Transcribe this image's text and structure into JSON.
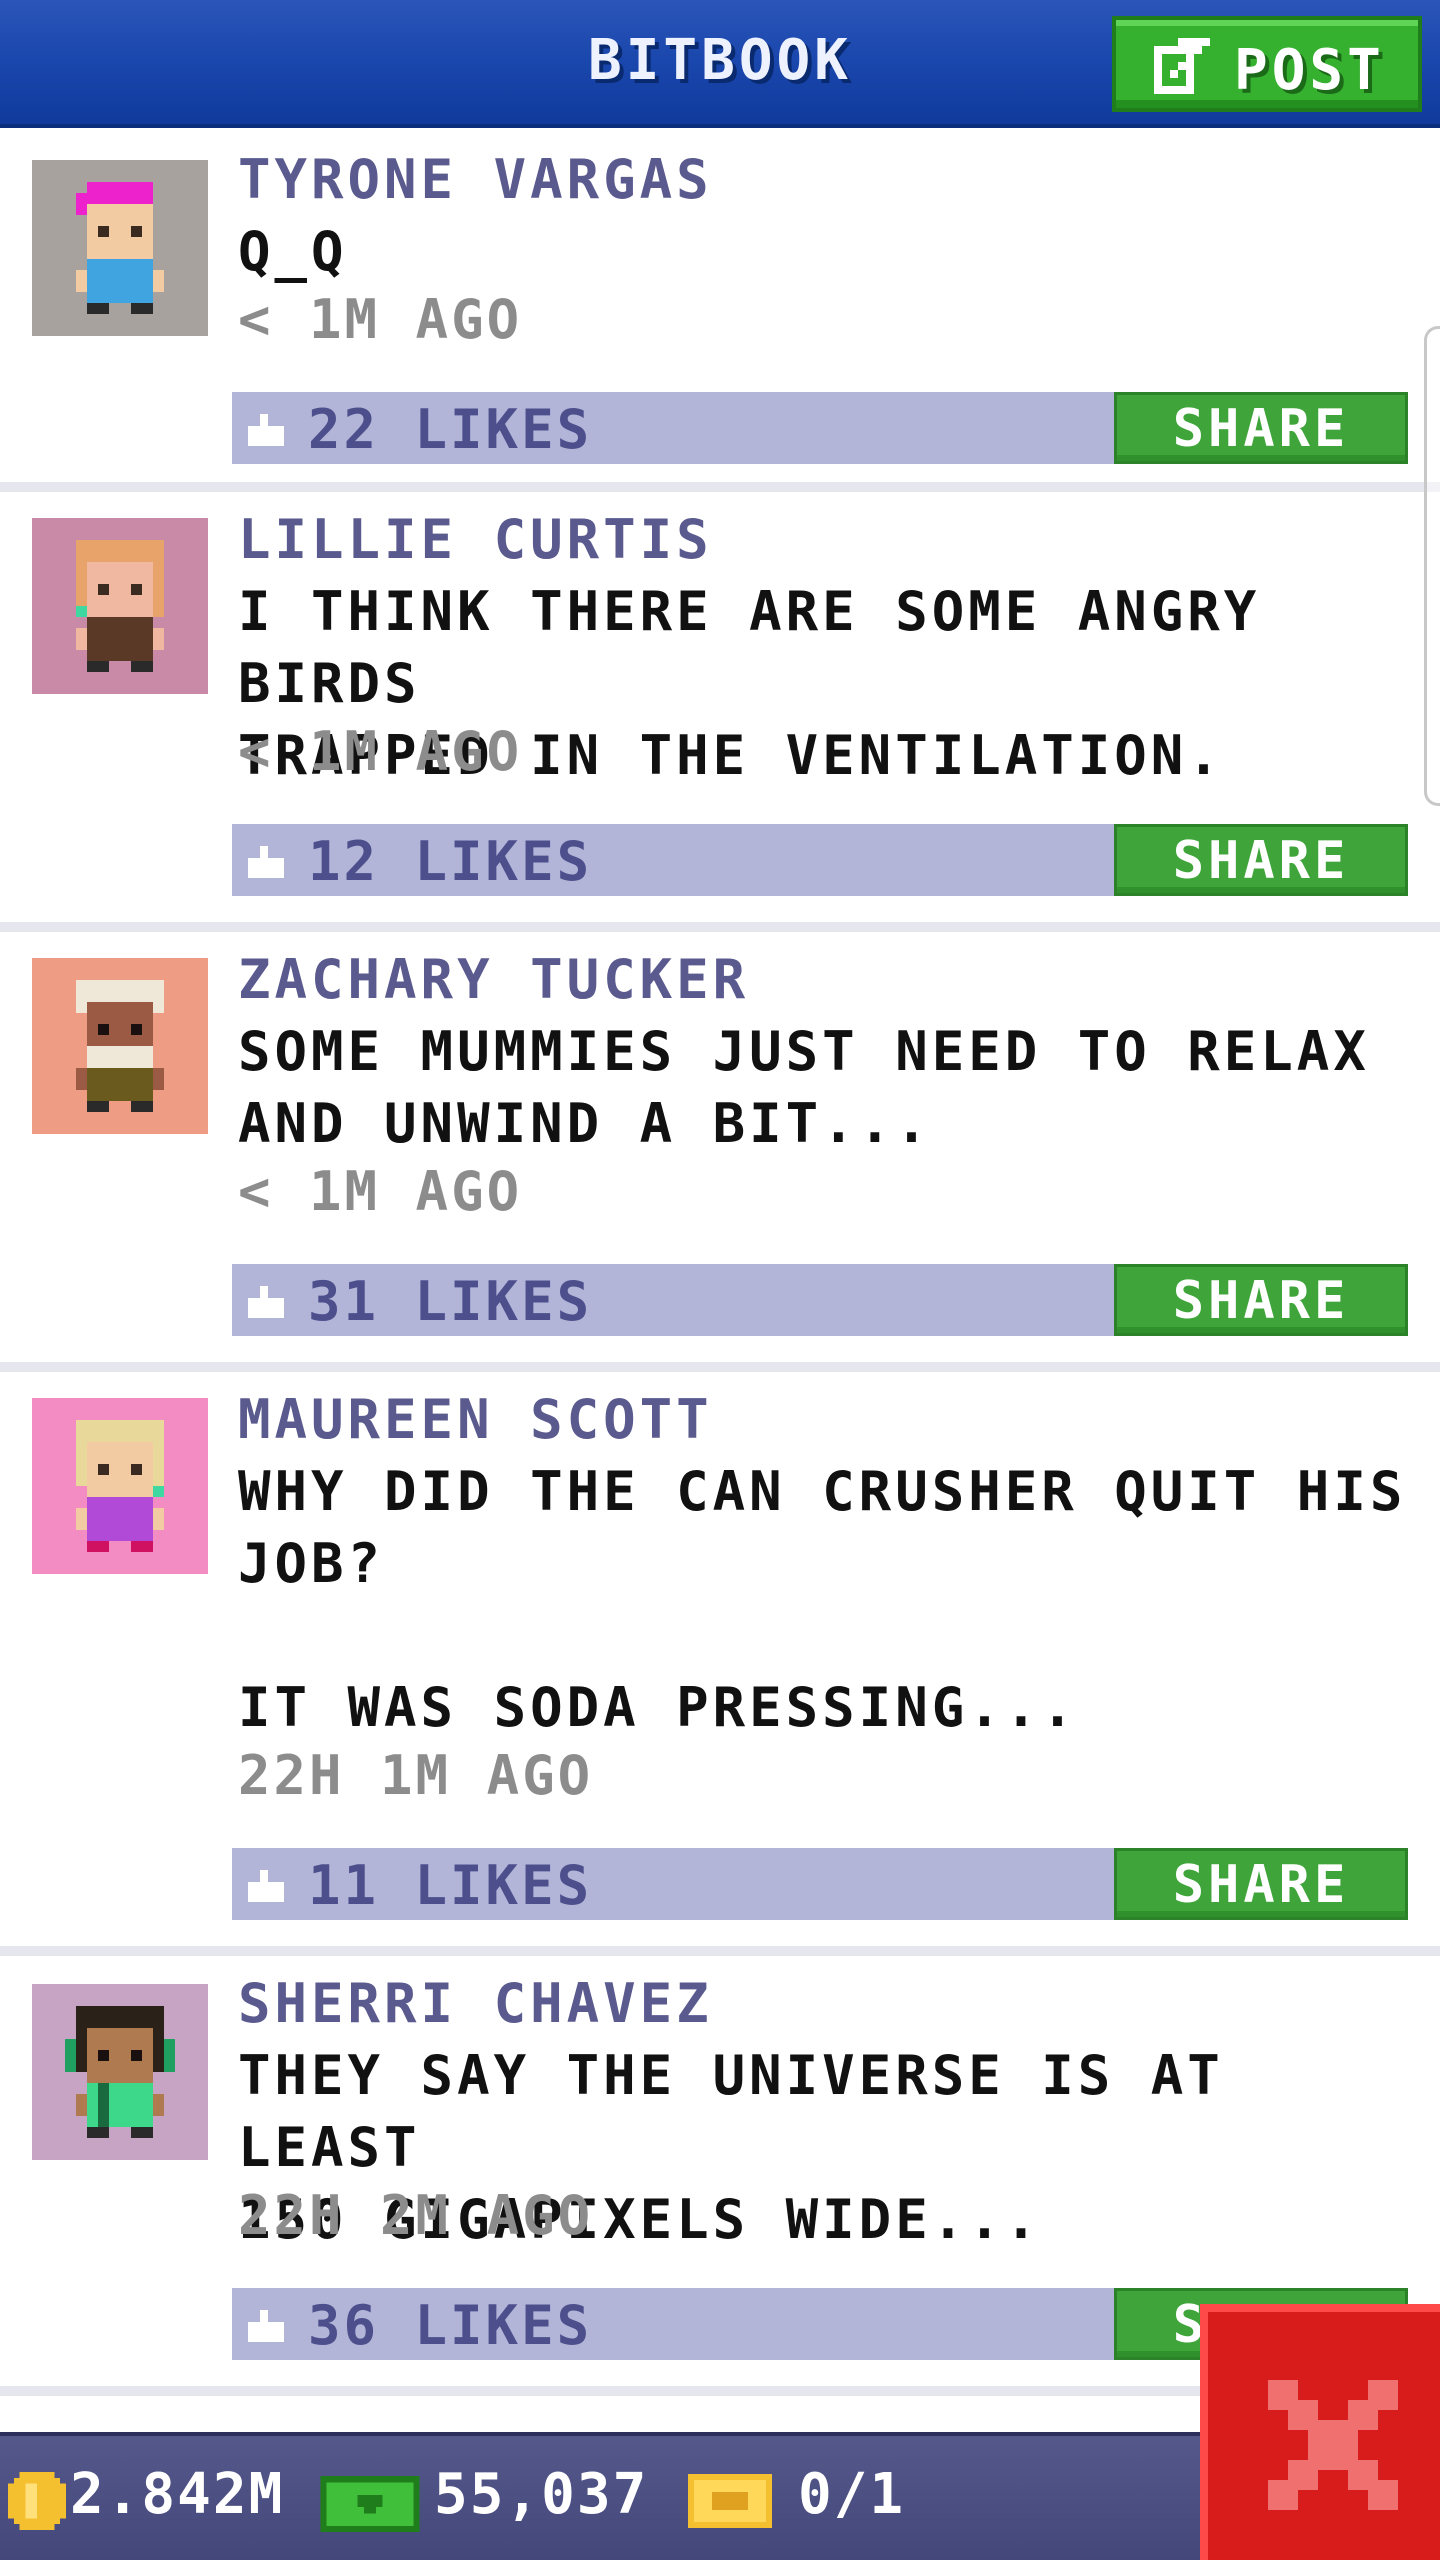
{
  "header": {
    "title": "BITBOOK",
    "post_label": "POST"
  },
  "posts": [
    {
      "name": "TYRONE VARGAS",
      "text": "Q_Q",
      "time": "< 1M AGO",
      "likes": "22 LIKES",
      "share_label": "SHARE",
      "avatar_bg": "#a8a29f",
      "hair_color": "#ee22cc",
      "shirt_color": "#3fa4e0"
    },
    {
      "name": "LILLIE CURTIS",
      "text": "I THINK THERE ARE SOME ANGRY BIRDS\nTRAPPED IN THE VENTILATION.",
      "time": "< 1M AGO",
      "likes": "12 LIKES",
      "share_label": "SHARE",
      "avatar_bg": "#c98aa8",
      "hair_color": "#e8a36a",
      "shirt_color": "#5a3a26"
    },
    {
      "name": "ZACHARY TUCKER",
      "text": "SOME MUMMIES JUST NEED TO RELAX\nAND UNWIND A BIT...",
      "time": "< 1M AGO",
      "likes": "31 LIKES",
      "share_label": "SHARE",
      "avatar_bg": "#ee9c84",
      "hair_color": "#efe7d8",
      "shirt_color": "#6a5a1e"
    },
    {
      "name": "MAUREEN SCOTT",
      "text": "WHY DID THE CAN CRUSHER QUIT HIS\nJOB?\n\nIT WAS SODA PRESSING...",
      "time": "22H 1M AGO",
      "likes": "11 LIKES",
      "share_label": "SHARE",
      "avatar_bg": "#f48cc4",
      "hair_color": "#e8d89a",
      "shirt_color": "#b24ad8"
    },
    {
      "name": "SHERRI CHAVEZ",
      "text": "THEY SAY THE UNIVERSE IS AT LEAST\n150 GIGAPIXELS WIDE...",
      "time": "22H 2M AGO",
      "likes": "36 LIKES",
      "share_label": "SHARE",
      "avatar_bg": "#c8a4c4",
      "hair_color": "#2a2218",
      "shirt_color": "#3ed88a"
    }
  ],
  "bottom_bar": {
    "coins": "2.842M",
    "bux": "55,037",
    "tickets": "0/1"
  },
  "colors": {
    "accent_green": "#3fa53a",
    "like_bar": "#b2b4d8",
    "header_blue": "#1a47ad",
    "close_red": "#d81c1c"
  },
  "icons": {
    "post": "edit-icon",
    "like": "thumbs-up-icon",
    "coin": "coin-icon",
    "bux": "bitbux-icon",
    "ticket": "ticket-icon",
    "close": "close-icon"
  }
}
